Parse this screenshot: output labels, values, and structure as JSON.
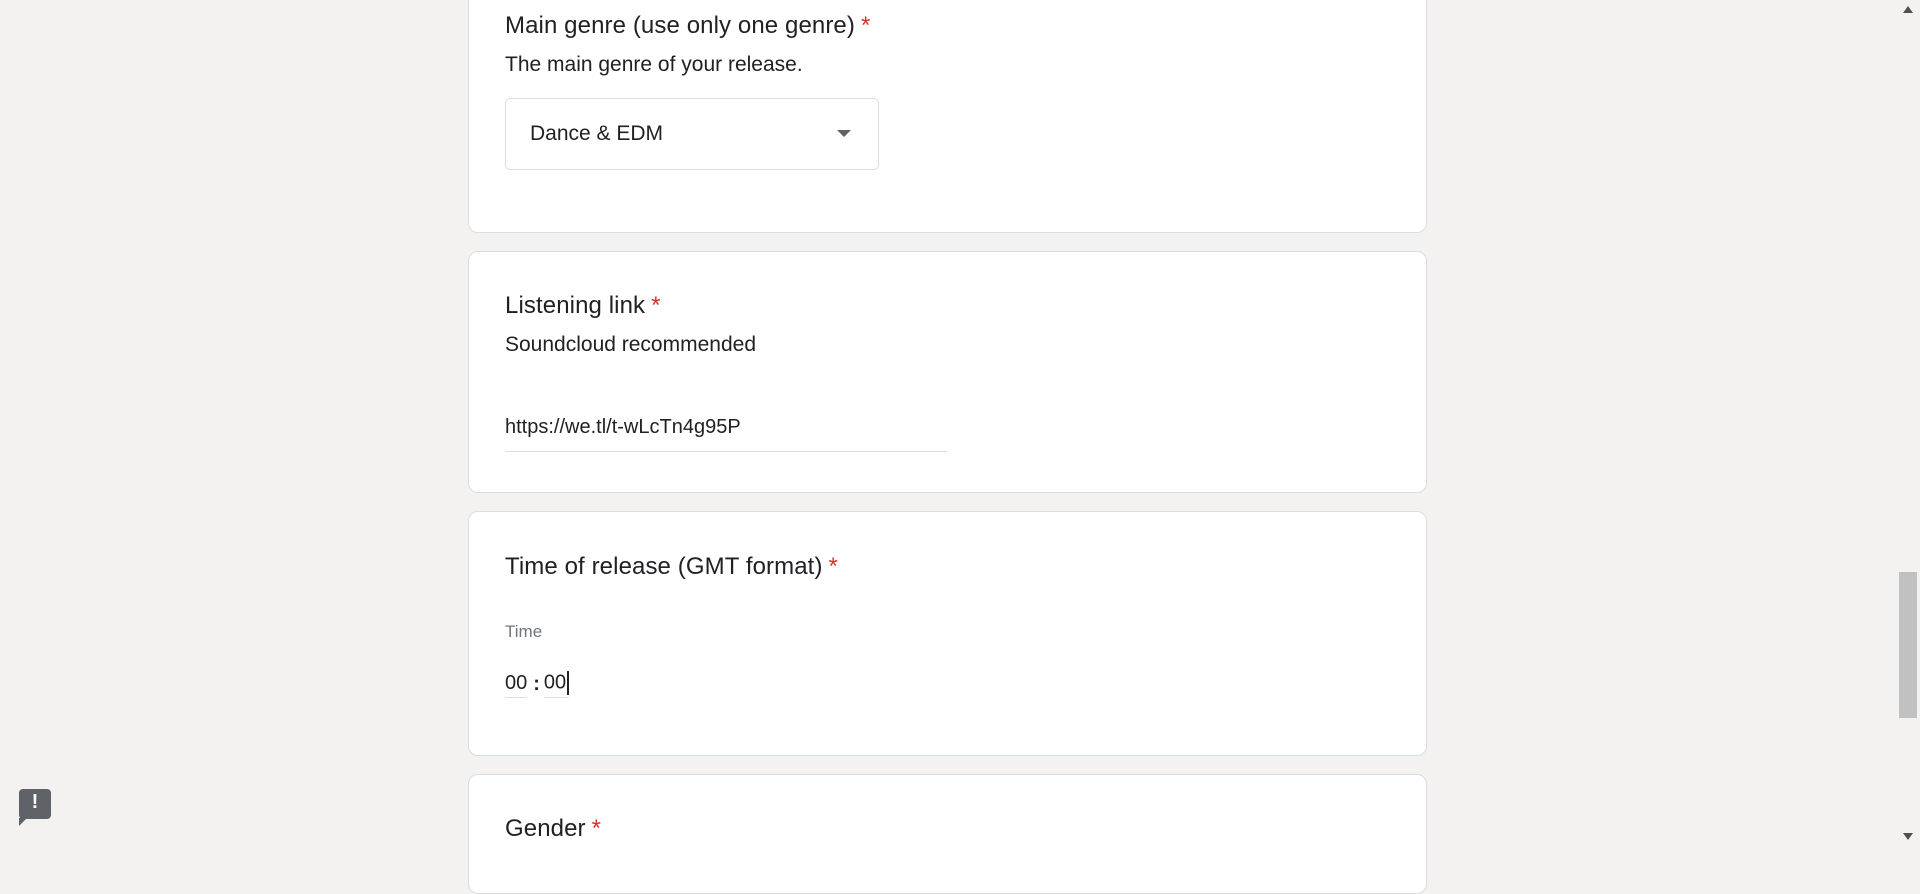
{
  "questions": {
    "genre": {
      "title": "Main genre (use only one genre)",
      "required_mark": "*",
      "description": "The main genre of your release.",
      "selected_value": "Dance & EDM"
    },
    "listening": {
      "title": "Listening link",
      "required_mark": "*",
      "description": "Soundcloud recommended",
      "value": "https://we.tl/t-wLcTn4g95P"
    },
    "time": {
      "title": "Time of release (GMT format)",
      "required_mark": "*",
      "label": "Time",
      "hours": "00",
      "separator": ":",
      "minutes": "00"
    },
    "gender": {
      "title": "Gender",
      "required_mark": "*"
    }
  },
  "icons": {
    "feedback": "report-feedback-icon",
    "dropdown": "chevron-down-icon"
  },
  "colors": {
    "required": "#d93025",
    "background": "#f4f2f1",
    "card": "#ffffff"
  }
}
